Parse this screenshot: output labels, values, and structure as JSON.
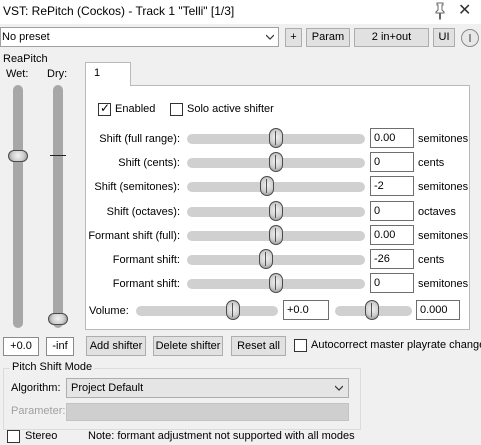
{
  "window": {
    "title": "VST: RePitch (Cockos) - Track 1 \"Telli\" [1/3]"
  },
  "toolbar": {
    "preset_value": "No preset",
    "plus_label": "+",
    "param_label": "Param",
    "io_label": "2 in+out",
    "ui_label": "UI"
  },
  "plugin": {
    "name": "ReaPitch",
    "wet_label": "Wet:",
    "dry_label": "Dry:",
    "wet_value": "+0.0",
    "dry_value": "-inf"
  },
  "tab": {
    "label": "1"
  },
  "panel": {
    "enabled_label": "Enabled",
    "enabled_checked": true,
    "solo_label": "Solo active shifter",
    "solo_checked": false,
    "rows": [
      {
        "label": "Shift (full range):",
        "value": "0.00",
        "unit": "semitones",
        "level": 0.5
      },
      {
        "label": "Shift (cents):",
        "value": "0",
        "unit": "cents",
        "level": 0.5
      },
      {
        "label": "Shift (semitones):",
        "value": "-2",
        "unit": "semitones",
        "level": 0.45
      },
      {
        "label": "Shift (octaves):",
        "value": "0",
        "unit": "octaves",
        "level": 0.5
      },
      {
        "label": "Formant shift (full):",
        "value": "0.00",
        "unit": "semitones",
        "level": 0.5
      },
      {
        "label": "Formant shift:",
        "value": "-26",
        "unit": "cents",
        "level": 0.44
      },
      {
        "label": "Formant shift:",
        "value": "0",
        "unit": "semitones",
        "level": 0.5
      }
    ],
    "volume_label": "Volume:",
    "volume_value": "+0.0",
    "pan_value": "0.000"
  },
  "actions": {
    "add_label": "Add shifter",
    "delete_label": "Delete shifter",
    "reset_label": "Reset all",
    "autocorrect_label": "Autocorrect master playrate changes",
    "autocorrect_checked": false
  },
  "mode": {
    "group_label": "Pitch Shift Mode",
    "algorithm_label": "Algorithm:",
    "algorithm_value": "Project Default",
    "parameter_label": "Parameter:",
    "stereo_label": "Stereo",
    "stereo_checked": false,
    "note": "Note: formant adjustment not supported with all modes"
  }
}
